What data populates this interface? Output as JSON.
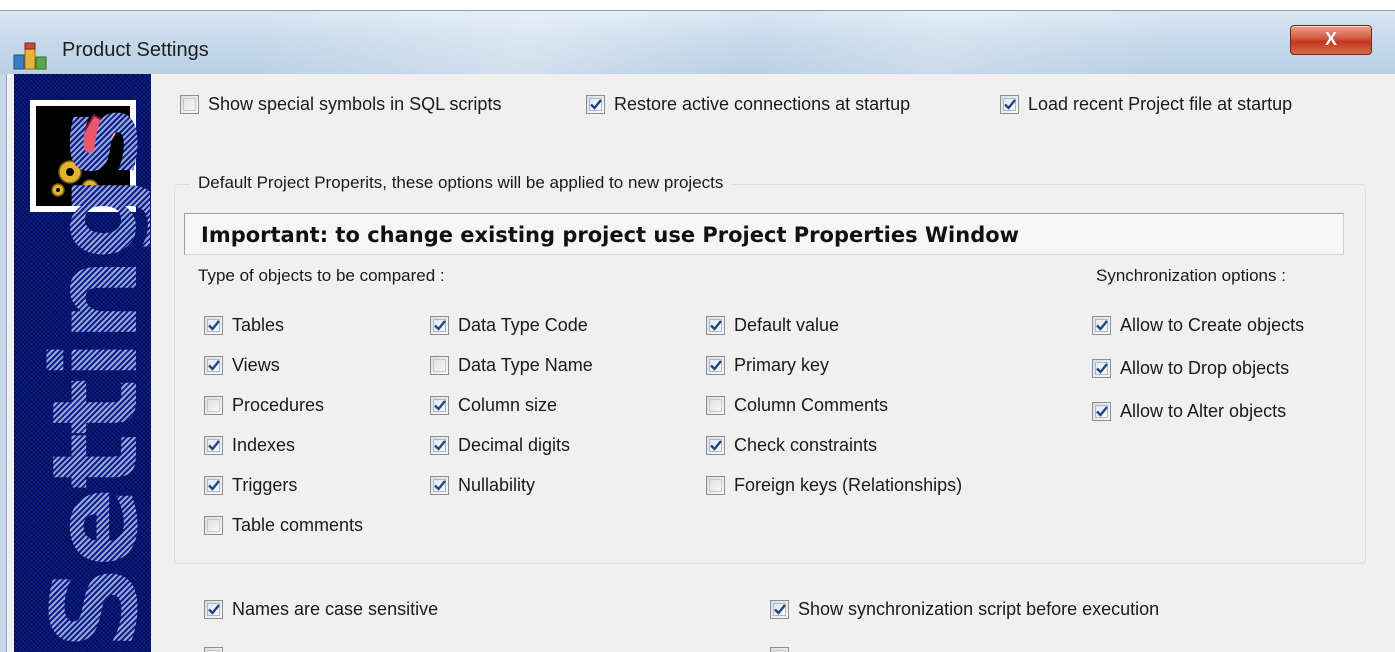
{
  "window": {
    "title": "Product Settings",
    "close_label": "X",
    "sidebar_word": "Settings"
  },
  "general": {
    "show_symbols": {
      "label": "Show special symbols in SQL scripts",
      "checked": false
    },
    "restore_connections": {
      "label": "Restore active connections at startup",
      "checked": true
    },
    "load_recent": {
      "label": "Load recent Project file at startup",
      "checked": true
    }
  },
  "defaults": {
    "legend": "Default Project Properits, these options will be applied to new projects",
    "important": "Important: to change existing project use Project Properties Window",
    "objects_label": "Type of objects to be compared :",
    "sync_label": "Synchronization options :"
  },
  "objects": [
    {
      "label": "Tables",
      "checked": true
    },
    {
      "label": "Views",
      "checked": true
    },
    {
      "label": "Procedures",
      "checked": false
    },
    {
      "label": "Indexes",
      "checked": true
    },
    {
      "label": "Triggers",
      "checked": true
    },
    {
      "label": "Table comments",
      "checked": false
    }
  ],
  "datatype": [
    {
      "label": "Data Type Code",
      "checked": true
    },
    {
      "label": "Data Type Name",
      "checked": false
    },
    {
      "label": "Column size",
      "checked": true
    },
    {
      "label": "Decimal digits",
      "checked": true
    },
    {
      "label": "Nullability",
      "checked": true
    }
  ],
  "constraints": [
    {
      "label": "Default value",
      "checked": true
    },
    {
      "label": "Primary key",
      "checked": true
    },
    {
      "label": "Column Comments",
      "checked": false
    },
    {
      "label": "Check constraints",
      "checked": true
    },
    {
      "label": "Foreign keys (Relationships)",
      "checked": false
    }
  ],
  "sync": [
    {
      "label": "Allow to Create objects",
      "checked": true
    },
    {
      "label": "Allow to Drop objects",
      "checked": true
    },
    {
      "label": "Allow to Alter objects",
      "checked": true
    }
  ],
  "bottom": {
    "case_sensitive": {
      "label": "Names are case sensitive",
      "checked": true
    },
    "show_script": {
      "label": "Show synchronization script before execution",
      "checked": true
    }
  }
}
